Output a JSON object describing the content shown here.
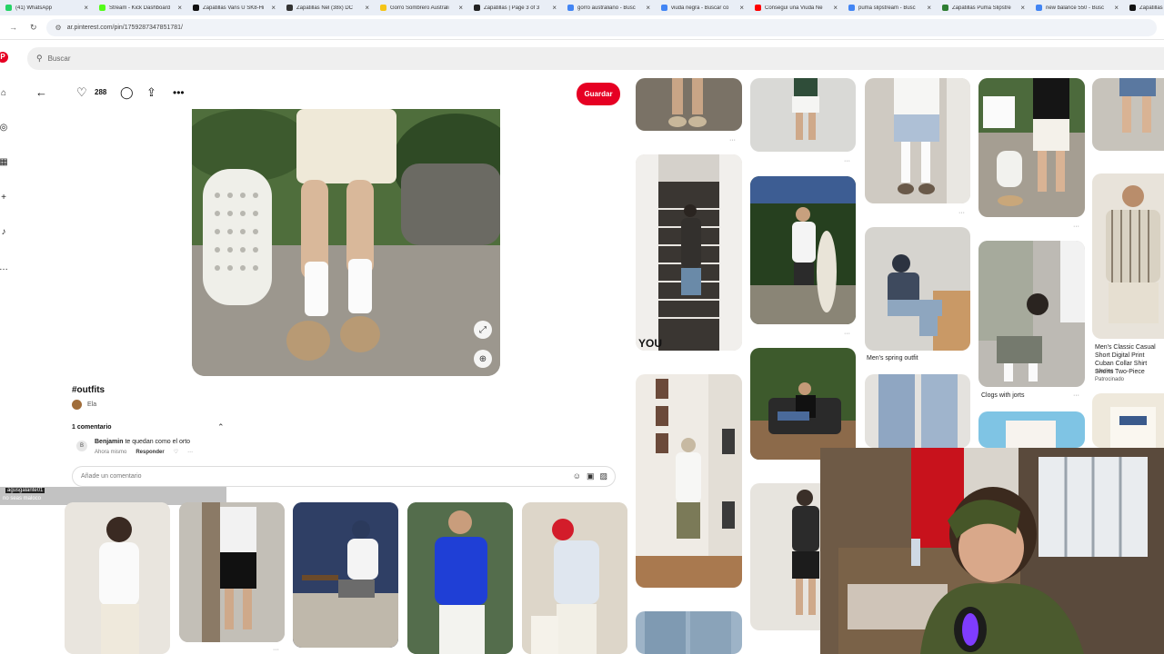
{
  "browser": {
    "tabs": [
      {
        "title": "(41) WhatsApp",
        "color": "#25d366"
      },
      {
        "title": "Stream - Kick Dashboard",
        "color": "#53fc18"
      },
      {
        "title": "Zapatillas Vans U SK8-Hi",
        "color": "#111111"
      },
      {
        "title": "Zapatillas Nel (38x) DC",
        "color": "#333333"
      },
      {
        "title": "Gorro Sombrero Australi",
        "color": "#f5c518"
      },
      {
        "title": "Zapatillas | Page 3 of 3",
        "color": "#222222"
      },
      {
        "title": "gorro australiano - Busc",
        "color": "#4285f4"
      },
      {
        "title": "viuda negra - Buscar co",
        "color": "#4285f4"
      },
      {
        "title": "Conseguí una Viuda Ne",
        "color": "#ff0000"
      },
      {
        "title": "puma slipstream - Busc",
        "color": "#4285f4"
      },
      {
        "title": "Zapatillas Puma Slipstre",
        "color": "#2e7d32"
      },
      {
        "title": "new balance 550 - Busc",
        "color": "#4285f4"
      },
      {
        "title": "Zapatillas Puma",
        "color": "#111111"
      }
    ],
    "url": "ar.pinterest.com/pin/1759287347851781/",
    "close_glyph": "×",
    "back_glyph": "→",
    "reload_glyph": "↻",
    "tune_glyph": "⚙"
  },
  "sidebar": {
    "logo": "P",
    "icons": [
      "home-icon",
      "explore-icon",
      "boards-icon",
      "create-icon",
      "notifications-icon",
      "messages-icon"
    ],
    "glyphs": [
      "⌂",
      "◎",
      "▦",
      "+",
      "♪",
      "…"
    ]
  },
  "search": {
    "placeholder": "Buscar",
    "glyph": "⚲"
  },
  "pin": {
    "likes": "288",
    "save_label": "Guardar",
    "title": "#outfits",
    "author": "Ela",
    "comments_header": "1 comentario",
    "comment": {
      "avatar_letter": "B",
      "user": "Benjamin",
      "text": "te quedan como el orto",
      "time": "Ahora mismo",
      "reply_label": "Responder",
      "more": "···"
    },
    "add_comment_placeholder": "Añade un comentario",
    "glyphs": {
      "back": "←",
      "heart": "♡",
      "comment": "◯",
      "share": "⇪",
      "more": "•••",
      "expand": "⤢",
      "lens": "⊕",
      "chev_up": "⌃",
      "emoji": "☺",
      "sticker": "▣",
      "image": "▨"
    }
  },
  "chat": {
    "username": "agusgalante01",
    "message": "no seas maloco"
  },
  "grid_captions": {
    "spring_outfit": "Men's spring outfit",
    "clogs": "Clogs with jorts",
    "ad_title": "Men's Classic Casual Short Digital Print Cuban Collar Shirt Shorts Two-Piece",
    "ad_brand": "svedios",
    "ad_sponsored": "Patrocinado"
  },
  "colors": {
    "brand": "#e60023"
  }
}
